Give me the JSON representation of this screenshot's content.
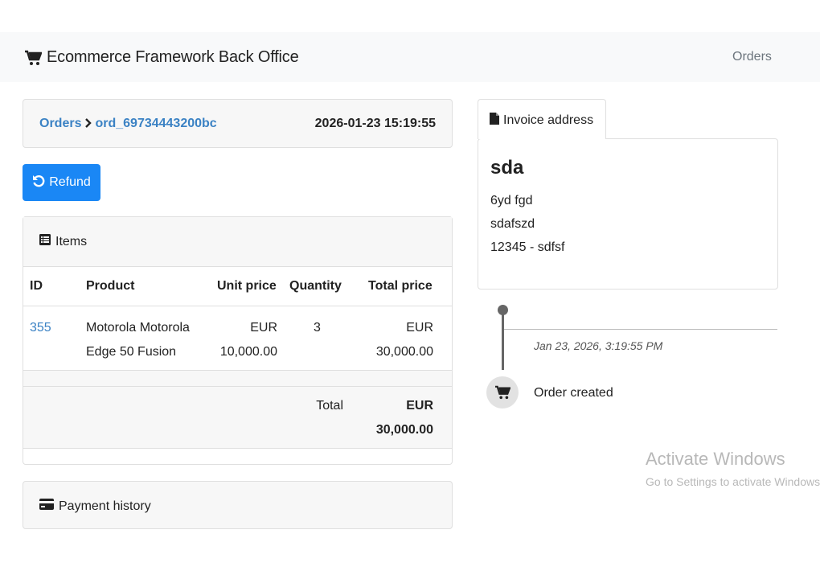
{
  "header": {
    "brand": "Ecommerce Framework Back Office",
    "nav_orders": "Orders"
  },
  "breadcrumb": {
    "root": "Orders",
    "order_id": "ord_69734443200bc",
    "date": "2026-01-23 15:19:55"
  },
  "actions": {
    "refund_label": "Refund"
  },
  "items": {
    "title": "Items",
    "columns": [
      "ID",
      "Product",
      "Unit price",
      "Quantity",
      "Total price"
    ],
    "rows": [
      {
        "id": "355",
        "product_line1": "Motorola Motorola",
        "product_line2": "Edge 50 Fusion",
        "unit_currency": "EUR",
        "unit_amount": "10,000.00",
        "quantity": "3",
        "total_currency": "EUR",
        "total_amount": "30,000.00"
      }
    ],
    "total_label": "Total",
    "total_currency": "EUR",
    "total_amount": "30,000.00"
  },
  "payment": {
    "title": "Payment history"
  },
  "invoice": {
    "tab_label": "Invoice address",
    "name": "sda",
    "line1": "6yd fgd",
    "line2": "sdafszd",
    "line3": "12345 - sdfsf"
  },
  "timeline": {
    "date": "Jan 23, 2026, 3:19:55 PM",
    "event": "Order created"
  },
  "watermark": {
    "title": "Activate Windows",
    "subtitle": "Go to Settings to activate Windows."
  },
  "colors": {
    "link": "#3b82c4",
    "primary_button": "#1a87f5",
    "panel_header": "#f7f7f7"
  }
}
